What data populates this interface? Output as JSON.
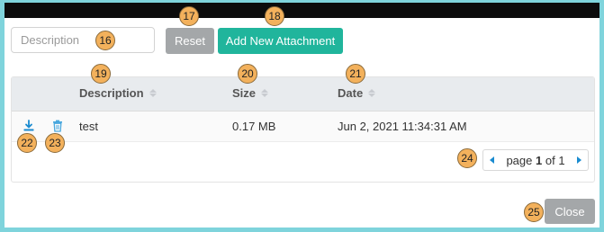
{
  "search": {
    "placeholder": "Description"
  },
  "toolbar": {
    "reset_label": "Reset",
    "add_label": "Add New Attachment"
  },
  "table": {
    "columns": [
      "Description",
      "Size",
      "Date"
    ],
    "rows": [
      {
        "description": "test",
        "size": "0.17 MB",
        "date": "Jun 2, 2021 11:34:31 AM"
      }
    ]
  },
  "pagination": {
    "prefix": "page",
    "current": "1",
    "middle": "of",
    "total": "1"
  },
  "footer": {
    "close_label": "Close"
  },
  "badges": {
    "search": "16",
    "reset": "17",
    "add": "18",
    "col_description": "19",
    "col_size": "20",
    "col_date": "21",
    "download": "22",
    "delete": "23",
    "pager": "24",
    "close": "25"
  },
  "colors": {
    "accent": "#20b59c",
    "muted_button": "#a4a7a9",
    "link_blue": "#1a8bd0",
    "badge": "#f3b15c"
  },
  "icons": {
    "download": "download-icon",
    "delete": "trash-icon"
  }
}
